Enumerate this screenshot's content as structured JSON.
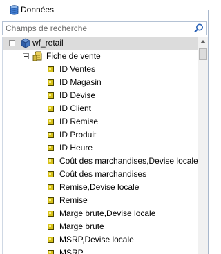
{
  "panel": {
    "title": "Données",
    "title_icon": "database-icon"
  },
  "search": {
    "placeholder": "Champs de recherche",
    "value": "",
    "button_icon": "search-icon"
  },
  "tree": {
    "root": {
      "label": "wf_retail",
      "icon": "cube-icon",
      "expanded": true
    },
    "table": {
      "label": "Fiche de vente",
      "icon": "table-folder-icon",
      "expanded": true
    },
    "fields": [
      "ID Ventes",
      "ID Magasin",
      "ID Devise",
      "ID Client",
      "ID Remise",
      "ID Produit",
      "ID Heure",
      "Coût des marchandises,Devise locale",
      "Coût des marchandises",
      "Remise,Devise locale",
      "Remise",
      "Marge brute,Devise locale",
      "Marge brute",
      "MSRP,Devise locale",
      "MSRP"
    ]
  },
  "colors": {
    "selected_row": "#dcdcdc",
    "border": "#a8b7cc",
    "field_icon": "#d8c21a"
  }
}
